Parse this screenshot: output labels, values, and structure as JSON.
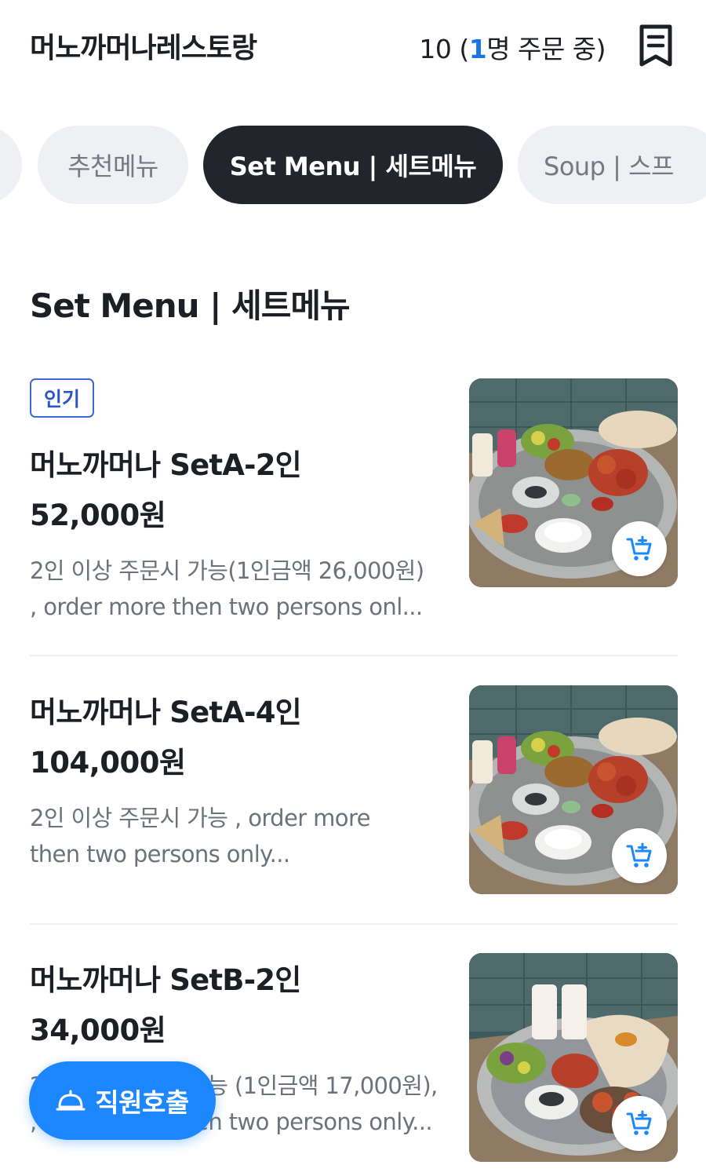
{
  "header": {
    "store_name": "머노까머나레스토랑",
    "table_number": "10",
    "order_paren_open": " (",
    "order_count": "1",
    "order_suffix": "명 주문 중)",
    "receipt_icon": "receipt-icon"
  },
  "tabs": [
    {
      "label": ""
    },
    {
      "label": "추천메뉴"
    },
    {
      "label": "Set Menu | 세트메뉴",
      "active": true
    },
    {
      "label": "Soup | 스프"
    }
  ],
  "section_title": "Set Menu | 세트메뉴",
  "items": [
    {
      "badge": "인기",
      "name": "머노까머나 SetA-2인",
      "price": "52,000원",
      "desc_line1": "2인 이상 주문시 가능(1인금액 26,000원)",
      "desc_line2": ", order more then two persons onl..."
    },
    {
      "name": "머노까머나 SetA-4인",
      "price": "104,000원",
      "desc_line1": "2인 이상 주문시 가능 , order more",
      "desc_line2": "then two persons only..."
    },
    {
      "name": "머노까머나 SetB-2인",
      "price": "34,000원",
      "desc_line1": "2인 이상 주문시 가능 (1인금액 17,000원),",
      "desc_line2": ", order more then two persons only..."
    }
  ],
  "call_staff": {
    "label": "직원호출",
    "icon": "service-bell-icon"
  },
  "colors": {
    "accent_blue": "#1c87ff",
    "active_tab": "#22262c",
    "badge_blue": "#2a56c6"
  }
}
